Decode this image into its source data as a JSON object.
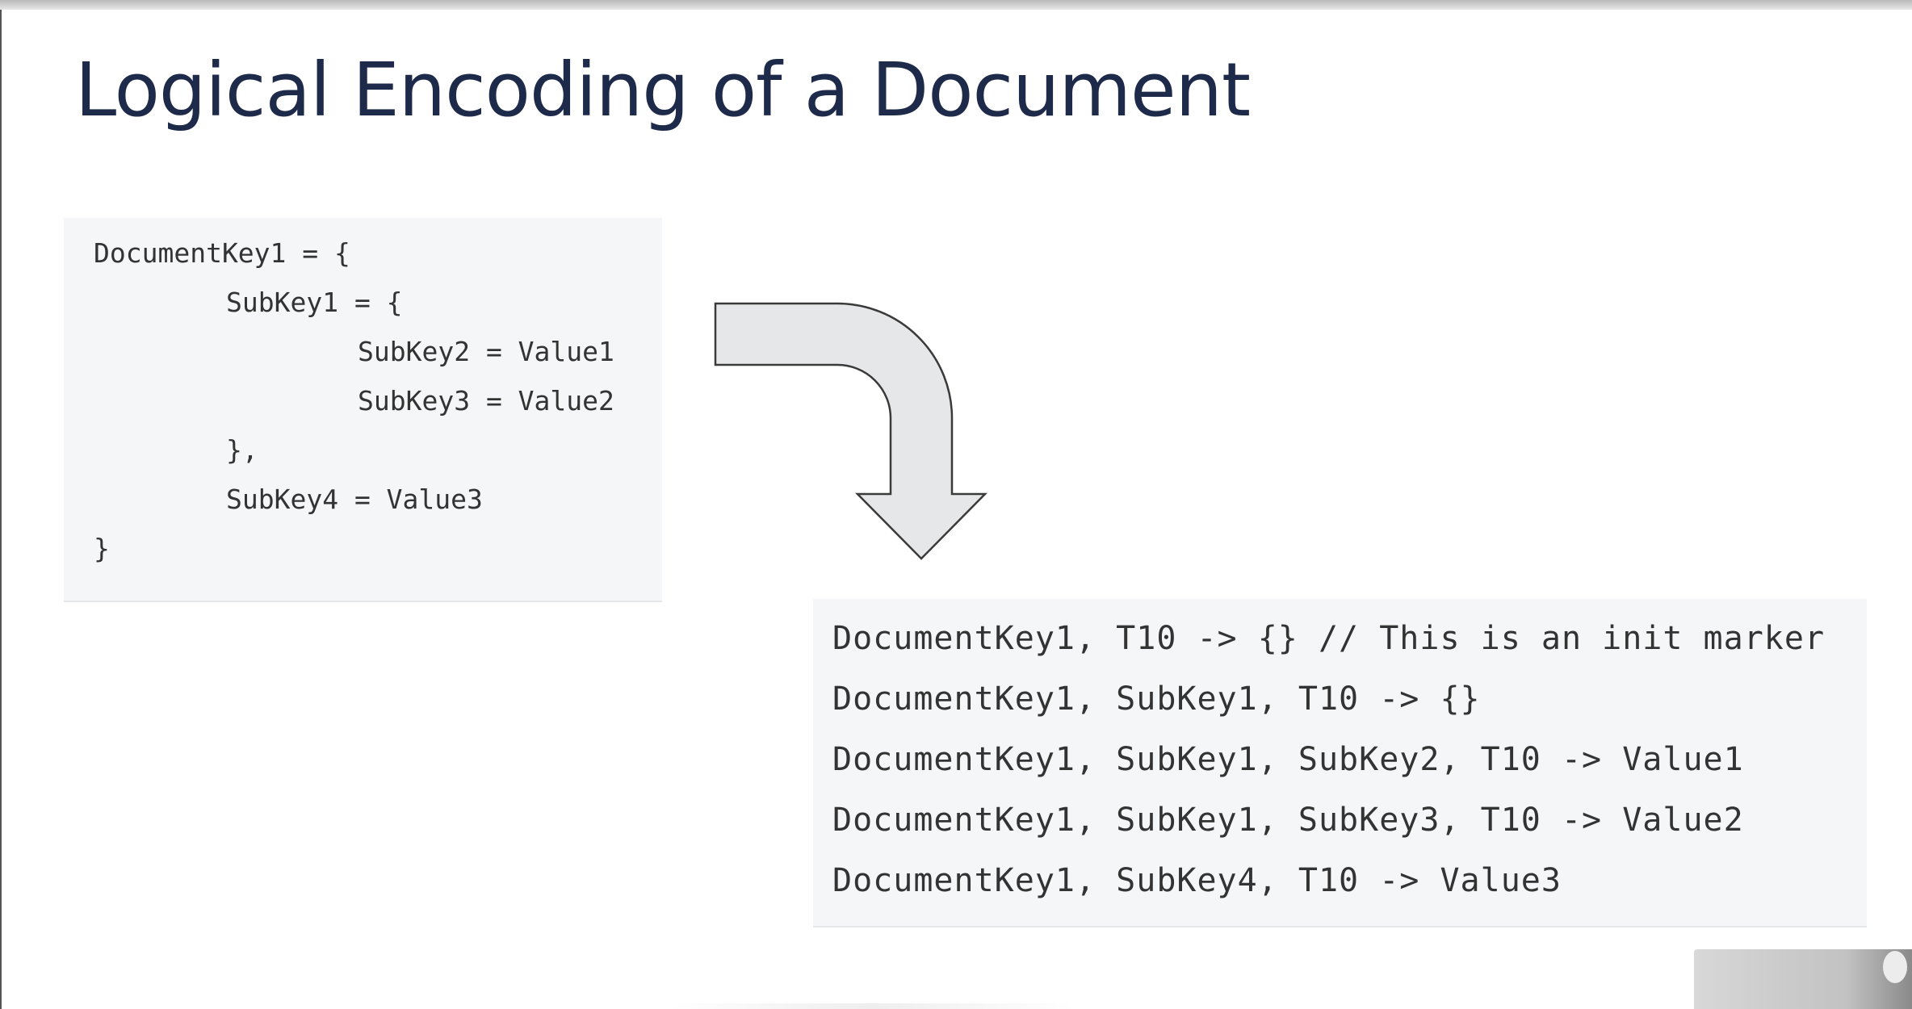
{
  "slide": {
    "title": "Logical Encoding of a Document"
  },
  "document_box": {
    "lines": [
      "DocumentKey1 = {",
      "SubKey1 = {",
      "SubKey2 = Value1",
      "SubKey3 = Value2",
      "},",
      "SubKey4 = Value3",
      "}"
    ]
  },
  "arrow": {
    "fill_color": "#e6e7e8",
    "stroke_color": "#3a3a3a",
    "icon": "curved-down-arrow-icon"
  },
  "encoded_box": {
    "lines": [
      "DocumentKey1, T10 -> {} // This is an init marker",
      "DocumentKey1, SubKey1, T10 -> {}",
      "DocumentKey1, SubKey1, SubKey2, T10 -> Value1",
      "DocumentKey1, SubKey1, SubKey3, T10 -> Value2",
      "DocumentKey1, SubKey4, T10 -> Value3"
    ]
  },
  "colors": {
    "title": "#1e2a4a",
    "code_text": "#333333",
    "code_background": "#f5f6f7"
  }
}
